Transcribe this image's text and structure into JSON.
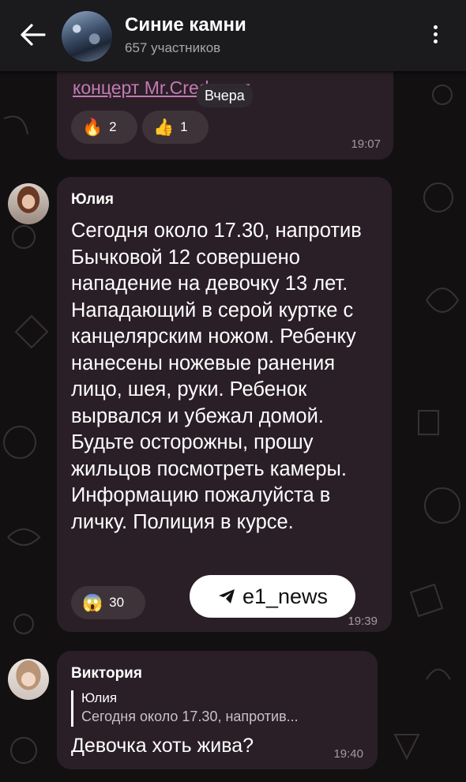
{
  "header": {
    "title": "Синие камни",
    "subtitle": "657 участников"
  },
  "messages": {
    "prev": {
      "link_text": "концерт Mr.Credo тут",
      "date_label": "Вчера",
      "reactions": [
        {
          "emoji": "🔥",
          "count": "2"
        },
        {
          "emoji": "👍",
          "count": "1"
        }
      ],
      "time": "19:07"
    },
    "yulia": {
      "sender": "Юлия",
      "text": "Сегодня около 17.30, напротив Бычковой 12 совершено нападение на девочку 13 лет. Нападающий в серой куртке с канцелярским ножом. Ребенку нанесены ножевые ранения лицо, шея, руки. Ребенок вырвался и убежал домой. Будьте осторожны, прошу жильцов посмотреть камеры. Информацию пожалуйста в личку. Полиция в курсе.",
      "reaction": {
        "emoji": "😱",
        "count": "30"
      },
      "time": "19:39"
    },
    "viktoria": {
      "sender": "Виктория",
      "reply_name": "Юлия",
      "reply_text": "Сегодня около 17.30, напротив...",
      "text": "Девочка хоть жива?",
      "time": "19:40"
    }
  },
  "watermark": {
    "text": "e1_news"
  }
}
